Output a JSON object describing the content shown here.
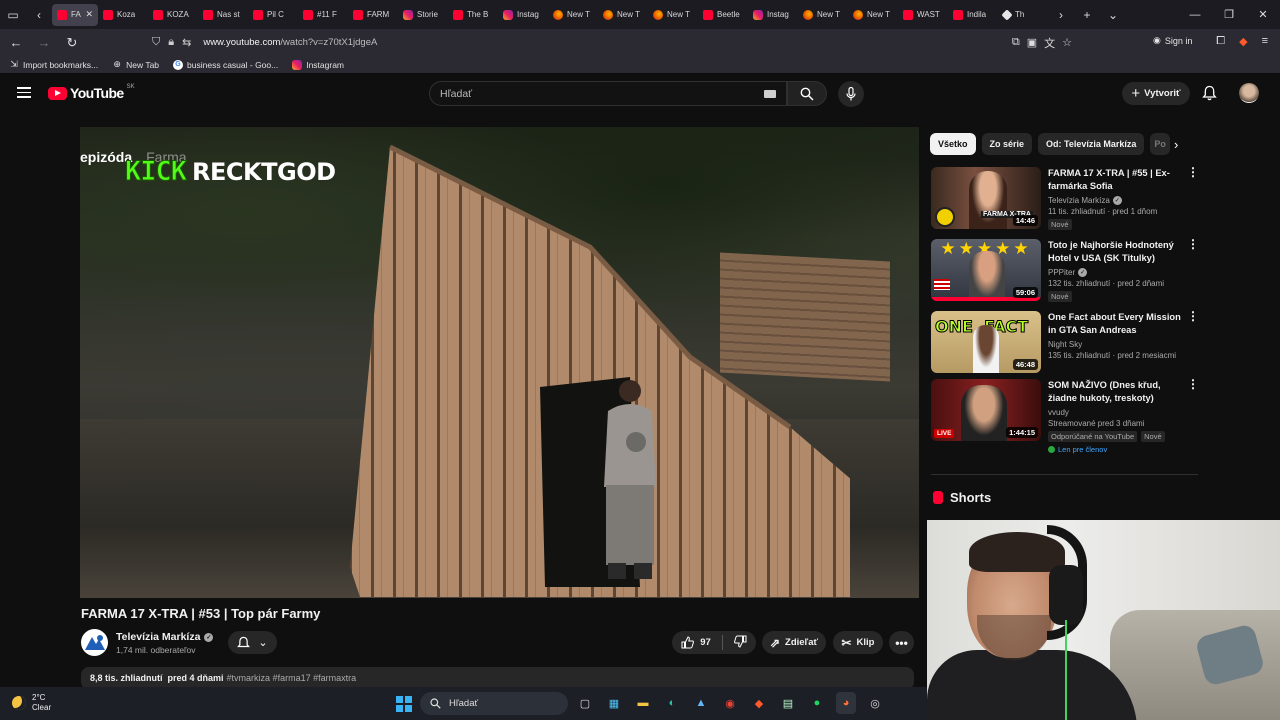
{
  "browser": {
    "tabs": [
      {
        "label": "FAR",
        "icon": "yt",
        "active": true
      },
      {
        "label": "Koza",
        "icon": "yt"
      },
      {
        "label": "KOZA",
        "icon": "yt"
      },
      {
        "label": "Nas st",
        "icon": "yt"
      },
      {
        "label": "Pil C",
        "icon": "yt"
      },
      {
        "label": "#11 F",
        "icon": "yt"
      },
      {
        "label": "FARM",
        "icon": "yt"
      },
      {
        "label": "Storie",
        "icon": "ig"
      },
      {
        "label": "The B",
        "icon": "yt"
      },
      {
        "label": "Instag",
        "icon": "ig"
      },
      {
        "label": "New T",
        "icon": "ff"
      },
      {
        "label": "New T",
        "icon": "ff"
      },
      {
        "label": "New T",
        "icon": "ff"
      },
      {
        "label": "Beetle",
        "icon": "yt"
      },
      {
        "label": "Instag",
        "icon": "ig"
      },
      {
        "label": "New T",
        "icon": "ff"
      },
      {
        "label": "New T",
        "icon": "ff"
      },
      {
        "label": "WAST",
        "icon": "yt"
      },
      {
        "label": "Indila",
        "icon": "yt"
      },
      {
        "label": "Th",
        "icon": "kk"
      }
    ],
    "url_host": "www.youtube.com",
    "url_path": "/watch?v=z70tX1jdgeA",
    "signin_label": "Sign in",
    "bookmarks": [
      {
        "label": "Import bookmarks...",
        "icon": "import-icon"
      },
      {
        "label": "New Tab",
        "icon": "globe-icon"
      },
      {
        "label": "business casual - Goo...",
        "icon": "google-icon"
      },
      {
        "label": "Instagram",
        "icon": "instagram-icon"
      }
    ]
  },
  "youtube": {
    "logo_text": "YouTube",
    "country_code": "SK",
    "search_placeholder": "Hľadať",
    "create_label": "Vytvoriť"
  },
  "video": {
    "overlay_episode": "epizóda",
    "overlay_farma": "Farma",
    "overlay_kick": "KICK",
    "overlay_name": "RECKTGOD",
    "title": "FARMA 17 X-TRA | #53 | Top pár Farmy",
    "channel": "Televízia Markíza",
    "subscribers": "1,74 mil. odberateľov",
    "likes": "97",
    "share_label": "Zdieľať",
    "clip_label": "Klip",
    "views": "8,8 tis. zhliadnutí",
    "date": "pred 4 dňami",
    "tags": "#tvmarkiza #farma17 #farmaxtra"
  },
  "sidebar": {
    "chips": [
      "Všetko",
      "Zo série",
      "Od: Televízia Markíza",
      "Po"
    ],
    "recommendations": [
      {
        "title": "FARMA 17 X-TRA | #55 | Ex-farmárka Sofia",
        "channel": "Televízia Markíza",
        "verified": true,
        "meta": "11 tis. zhliadnutí · pred 1 dňom",
        "duration": "14:46",
        "badges": [
          "Nové"
        ]
      },
      {
        "title": "Toto je Najhoršie Hodnotený Hotel v USA (SK Titulky)",
        "channel": "PPPiter",
        "verified": true,
        "meta": "132 tis. zhliadnutí · pred 2 dňami",
        "duration": "59:06",
        "badges": [
          "Nové"
        ]
      },
      {
        "title": "One Fact about Every Mission in GTA San Andreas",
        "channel": "Night Sky",
        "verified": false,
        "meta": "135 tis. zhliadnutí · pred 2 mesiacmi",
        "duration": "46:48",
        "badges": []
      },
      {
        "title": "SOM NAŽIVO (Dnes křud, žiadne hukoty, treskoty)",
        "channel": "vvudy",
        "verified": false,
        "meta": "Streamované pred 3 dňami",
        "duration": "1:44:15",
        "live": "LIVE",
        "badges": [
          "Odporúčané na YouTube",
          "Nové"
        ],
        "members": "Len pre členov"
      }
    ],
    "shorts_label": "Shorts"
  },
  "taskbar": {
    "temp": "2°C",
    "condition": "Clear",
    "search_placeholder": "Hľadať"
  }
}
